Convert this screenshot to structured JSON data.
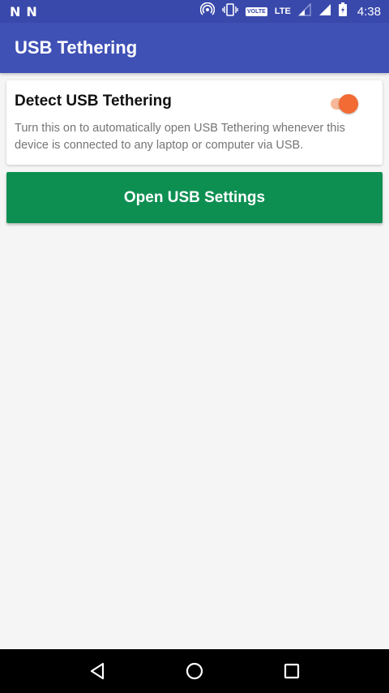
{
  "status_bar": {
    "left_icons": [
      "N",
      "N"
    ],
    "volte": "VOLTE",
    "lte": "LTE",
    "time": "4:38"
  },
  "app_bar": {
    "title": "USB Tethering"
  },
  "detect_card": {
    "title": "Detect USB Tethering",
    "description": "Turn this on to automatically open USB Tethering whenever this device is connected to any laptop or computer via USB.",
    "toggle_on": true
  },
  "open_button": {
    "label": "Open USB Settings"
  },
  "colors": {
    "app_bar": "#3f51b5",
    "status_bar": "#3949ab",
    "accent": "#f26b35",
    "button": "#0d8f52"
  },
  "nav_bar": {
    "icons": [
      "back-icon",
      "home-icon",
      "recents-icon"
    ]
  }
}
